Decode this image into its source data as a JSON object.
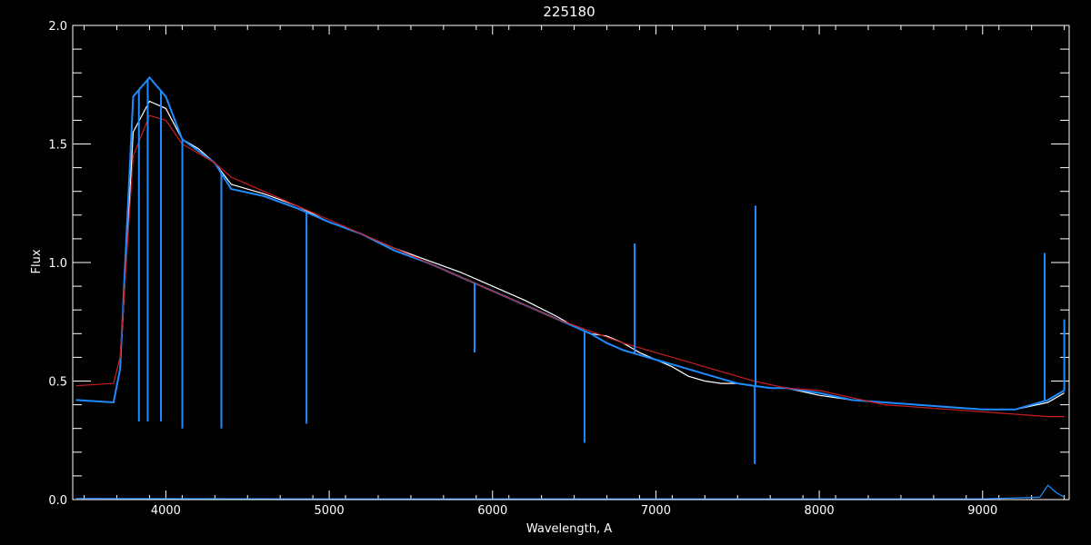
{
  "chart_data": {
    "type": "line",
    "title": "225180",
    "xlabel": "Wavelength, A",
    "ylabel": "Flux",
    "xlim": [
      3430,
      9530
    ],
    "ylim": [
      0.0,
      2.0
    ],
    "xticks": [
      4000,
      5000,
      6000,
      7000,
      8000,
      9000
    ],
    "xtick_labels": [
      "4000",
      "5000",
      "6000",
      "7000",
      "8000",
      "9000"
    ],
    "yticks": [
      0.0,
      0.5,
      1.0,
      1.5,
      2.0
    ],
    "ytick_labels": [
      "0.0",
      "0.5",
      "1.0",
      "1.5",
      "2.0"
    ],
    "grid": false,
    "background": "#000000",
    "series": [
      {
        "role": "observed spectrum (white)",
        "color": "#ffffff",
        "x": [
          3450,
          3680,
          3720,
          3800,
          3900,
          4000,
          4100,
          4200,
          4300,
          4400,
          4600,
          4800,
          5000,
          5200,
          5400,
          5600,
          5800,
          6000,
          6200,
          6400,
          6500,
          6600,
          6700,
          6800,
          6900,
          7000,
          7100,
          7200,
          7300,
          7400,
          7500,
          7600,
          7700,
          7800,
          8000,
          8200,
          8400,
          8600,
          8800,
          9000,
          9200,
          9400,
          9500
        ],
        "y": [
          0.42,
          0.41,
          0.55,
          1.55,
          1.68,
          1.65,
          1.52,
          1.48,
          1.42,
          1.33,
          1.29,
          1.24,
          1.17,
          1.12,
          1.06,
          1.01,
          0.96,
          0.9,
          0.84,
          0.77,
          0.73,
          0.7,
          0.69,
          0.66,
          0.62,
          0.59,
          0.56,
          0.52,
          0.5,
          0.49,
          0.49,
          0.48,
          0.47,
          0.47,
          0.44,
          0.42,
          0.41,
          0.4,
          0.39,
          0.38,
          0.38,
          0.41,
          0.45
        ]
      },
      {
        "role": "observed spectrum (blue)",
        "color": "#1e8cff",
        "x": [
          3450,
          3680,
          3720,
          3800,
          3900,
          4000,
          4100,
          4200,
          4300,
          4400,
          4600,
          4800,
          5000,
          5200,
          5400,
          5600,
          5800,
          6000,
          6200,
          6400,
          6500,
          6600,
          6700,
          6800,
          6900,
          7000,
          7100,
          7200,
          7300,
          7400,
          7500,
          7600,
          7700,
          7800,
          8000,
          8200,
          8400,
          8600,
          8800,
          9000,
          9200,
          9400,
          9500
        ],
        "y": [
          0.42,
          0.41,
          0.55,
          1.7,
          1.78,
          1.7,
          1.52,
          1.47,
          1.42,
          1.31,
          1.28,
          1.23,
          1.17,
          1.12,
          1.05,
          1.0,
          0.94,
          0.88,
          0.82,
          0.76,
          0.73,
          0.7,
          0.66,
          0.63,
          0.61,
          0.59,
          0.57,
          0.55,
          0.53,
          0.51,
          0.49,
          0.48,
          0.47,
          0.47,
          0.45,
          0.42,
          0.41,
          0.4,
          0.39,
          0.38,
          0.38,
          0.42,
          0.46
        ]
      },
      {
        "role": "model fit (red)",
        "color": "#c81e1e",
        "x": [
          3450,
          3680,
          3720,
          3800,
          3900,
          4000,
          4100,
          4200,
          4300,
          4400,
          4600,
          4800,
          5000,
          5200,
          5400,
          5600,
          5800,
          6000,
          6200,
          6400,
          6600,
          6800,
          7000,
          7200,
          7400,
          7600,
          7800,
          8000,
          8200,
          8400,
          8600,
          8800,
          9000,
          9200,
          9400,
          9500
        ],
        "y": [
          0.48,
          0.49,
          0.6,
          1.45,
          1.62,
          1.6,
          1.5,
          1.46,
          1.42,
          1.36,
          1.3,
          1.24,
          1.18,
          1.12,
          1.06,
          1.0,
          0.94,
          0.88,
          0.82,
          0.76,
          0.71,
          0.66,
          0.62,
          0.58,
          0.54,
          0.5,
          0.47,
          0.46,
          0.43,
          0.4,
          0.39,
          0.38,
          0.37,
          0.36,
          0.35,
          0.35
        ]
      },
      {
        "role": "error spectrum (blue, near zero)",
        "color": "#1e8cff",
        "x": [
          3450,
          4000,
          5000,
          6000,
          7000,
          8000,
          9000,
          9350,
          9400,
          9450,
          9500
        ],
        "y": [
          0.005,
          0.004,
          0.003,
          0.003,
          0.003,
          0.003,
          0.003,
          0.01,
          0.06,
          0.03,
          0.01
        ]
      }
    ],
    "absorption_lines": [
      {
        "x": 3835,
        "depth_to": 0.33
      },
      {
        "x": 3889,
        "depth_to": 0.33
      },
      {
        "x": 3970,
        "depth_to": 0.33
      },
      {
        "x": 4101,
        "depth_to": 0.3
      },
      {
        "x": 4340,
        "depth_to": 0.3
      },
      {
        "x": 4861,
        "depth_to": 0.32
      },
      {
        "x": 5890,
        "depth_to": 0.62
      },
      {
        "x": 6563,
        "depth_to": 0.24
      },
      {
        "x": 7605,
        "depth_to": 0.15
      }
    ],
    "emission_spikes": [
      {
        "x": 6870,
        "peak": 1.08
      },
      {
        "x": 7610,
        "peak": 1.24
      },
      {
        "x": 9380,
        "peak": 1.04
      },
      {
        "x": 9500,
        "peak": 0.76
      }
    ]
  }
}
